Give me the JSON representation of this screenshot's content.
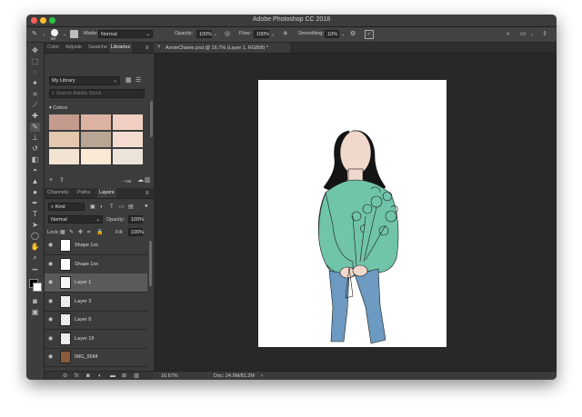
{
  "window": {
    "title": "Adobe Photoshop CC 2018"
  },
  "colors": {
    "accent_mint": "#70c4aa",
    "jeans": "#6c9ac0",
    "hair": "#141414",
    "skin": "#f0d8cc"
  },
  "options_bar": {
    "brush_size": "60",
    "mode_label": "Mode:",
    "mode_value": "Normal",
    "opacity_label": "Opacity:",
    "opacity_value": "100%",
    "flow_label": "Flow:",
    "flow_value": "100%",
    "smoothing_label": "Smoothing:",
    "smoothing_value": "10%"
  },
  "top_panel": {
    "tabs": [
      "Color",
      "Adjustn",
      "Swatche",
      "Libraries"
    ],
    "library_select": "My Library",
    "search_placeholder": "Search Adobe Stock",
    "section_label": "Colors",
    "swatches": [
      "#c49b8c",
      "#dcb3a2",
      "#f0cfc2",
      "#e3c7ae",
      "#b9a593",
      "#f3dccf",
      "#f2e3d2",
      "#fbe9d6",
      "#ece4d8"
    ],
    "size_readout": "-- KB"
  },
  "layers_panel": {
    "tabs": [
      "Channels",
      "Paths",
      "Layers"
    ],
    "kind_label": "Kind",
    "blend_mode": "Normal",
    "opacity_label": "Opacity:",
    "opacity_value": "100%",
    "lock_label": "Lock:",
    "fill_label": "Fill:",
    "fill_value": "100%",
    "layers": [
      {
        "name": "Shape 1xx"
      },
      {
        "name": "Shape 1xx"
      },
      {
        "name": "Layer 1"
      },
      {
        "name": "Layer 3"
      },
      {
        "name": "Layer 8"
      },
      {
        "name": "Layer 18"
      },
      {
        "name": "IMG_9584"
      },
      {
        "name": "Background"
      }
    ]
  },
  "document": {
    "tab_label": "AnnieChanie.psd @ 16.7% (Layer 1, RGB/8) *",
    "zoom": "16.67%",
    "doc_size": "Doc: 24.9M/81.2M"
  }
}
